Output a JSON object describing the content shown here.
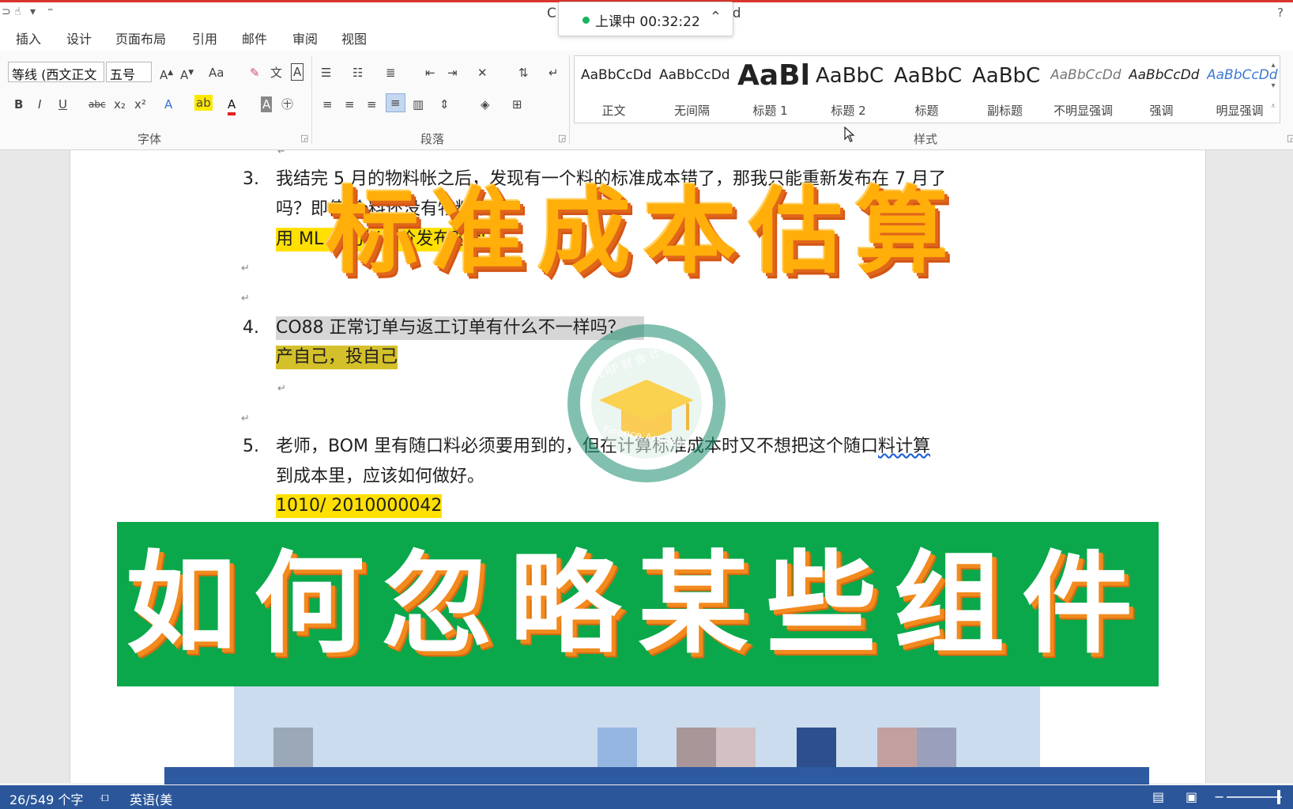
{
  "title_bar": {
    "title_left": "C",
    "title_right": "rd",
    "help": "?"
  },
  "class_timer": {
    "label": "上课中 00:32:22",
    "collapse": "^"
  },
  "tabs": [
    "插入",
    "设计",
    "页面布局",
    "引用",
    "邮件",
    "审阅",
    "视图"
  ],
  "ribbon": {
    "font_name": "等线 (西文正文",
    "font_size": "五号",
    "font_group_label": "字体",
    "paragraph_group_label": "段落",
    "styles_group_label": "样式",
    "change_case": "Aa",
    "font_buttons": [
      "B",
      "I",
      "U",
      "abc",
      "x₂",
      "x²",
      "A",
      "A",
      "A"
    ],
    "styles": [
      {
        "sample": "AaBbCcDd",
        "name": "正文"
      },
      {
        "sample": "AaBbCcDd",
        "name": "无间隔"
      },
      {
        "sample": "AaBl",
        "name": "标题 1"
      },
      {
        "sample": "AaBbC",
        "name": "标题 2"
      },
      {
        "sample": "AaBbC",
        "name": "标题"
      },
      {
        "sample": "AaBbC",
        "name": "副标题"
      },
      {
        "sample": "AaBbCcDd",
        "name": "不明显强调"
      },
      {
        "sample": "AaBbCcDd",
        "name": "强调"
      },
      {
        "sample": "AaBbCcDd",
        "name": "明显强调"
      }
    ]
  },
  "document": {
    "item3": {
      "num": "3.",
      "line1": "我结完 5 月的物料帐之后，发现有一个料的标准成本错了，那我只能重新发布在 7 月了",
      "line2": "吗？即使     个料还没有物料帐？",
      "line3": "     用 ML 月初标准价发布时间"
    },
    "item4": {
      "num": "4.",
      "line1": "CO88 正常订单与返工订单有什么不一样吗？",
      "line2": "产自己，投自己"
    },
    "item5": {
      "num": "5.",
      "line1_pre": "老师，BOM  里有随口料必须要用到的，但在计算标准成本时又不想把这个随口",
      "line1_err": "料计算",
      "line2": "到成本里，应该如何做好。",
      "line3": "1010/ 2010000042"
    },
    "para_mark": "↵"
  },
  "watermark": {
    "top": "ERP 财 会 计 堂",
    "bottom": "Finance Academy"
  },
  "overlays": {
    "title": "标准成本估算",
    "subtitle": "如何忽略某些组件"
  },
  "status_bar": {
    "word_count": "26/549 个字",
    "language": "英语(美"
  },
  "colors": {
    "accent_red": "#d9342b",
    "status_blue": "#2b579a",
    "banner_green": "#0aa84b",
    "title_orange": "#ffae0a",
    "highlight_yellow": "#ffe000"
  }
}
